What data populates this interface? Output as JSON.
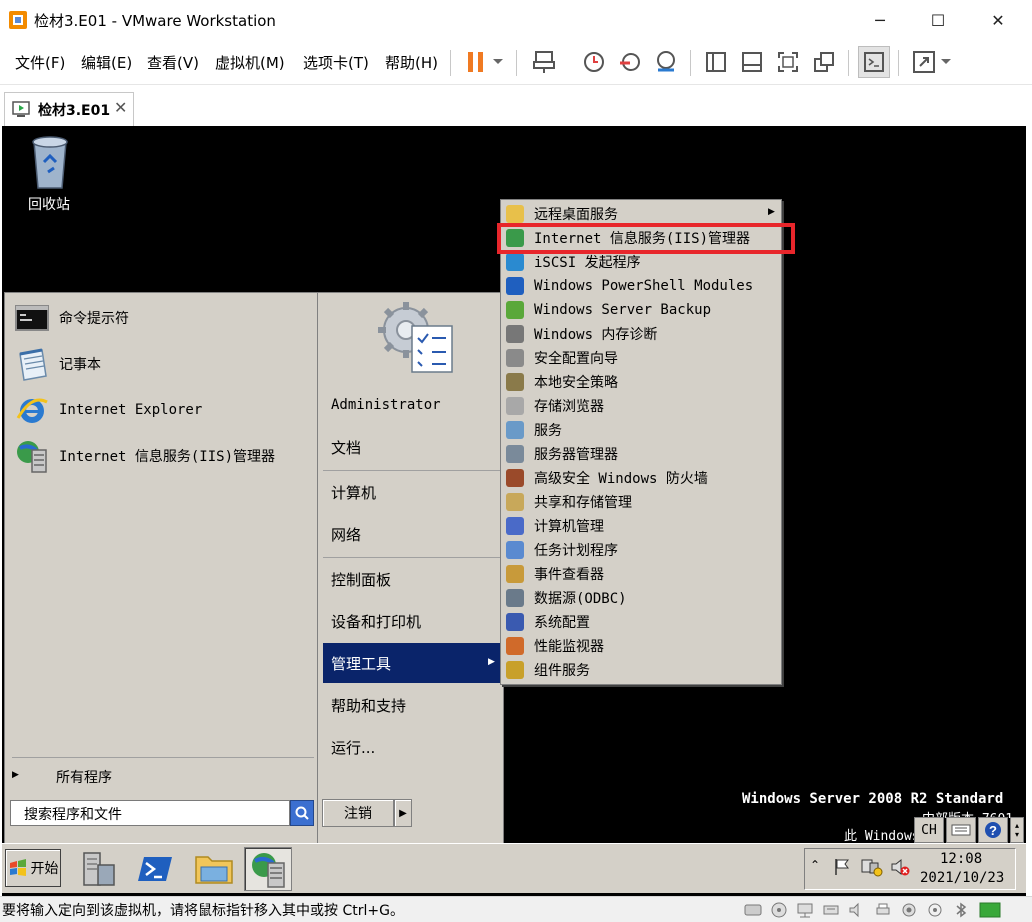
{
  "window": {
    "title": "检材3.E01 - VMware Workstation",
    "minimize": "─",
    "maximize": "☐",
    "close": "✕"
  },
  "menu": [
    "文件(F)",
    "编辑(E)",
    "查看(V)",
    "虚拟机(M)",
    "选项卡(T)",
    "帮助(H)"
  ],
  "tab": {
    "label": "检材3.E01",
    "close": "✕"
  },
  "guest": {
    "desktop": {
      "recycle_bin": "回收站"
    },
    "os_watermark_line1": "Windows Server 2008 R2 Standard",
    "os_watermark_line2": "中部版本 7601",
    "os_watermark_line3": "此 Windows",
    "start_menu": {
      "pinned": [
        "命令提示符",
        "记事本",
        "Internet Explorer",
        "Internet 信息服务(IIS)管理器"
      ],
      "all_programs": "所有程序",
      "search_placeholder": "搜索程序和文件",
      "user": "Administrator",
      "right_links": [
        "文档",
        "计算机",
        "网络",
        "控制面板",
        "设备和打印机",
        "管理工具",
        "帮助和支持",
        "运行..."
      ],
      "logoff": "注销"
    },
    "admin_tools_submenu": [
      "远程桌面服务",
      "Internet 信息服务(IIS)管理器",
      "iSCSI 发起程序",
      "Windows PowerShell Modules",
      "Windows Server Backup",
      "Windows 内存诊断",
      "安全配置向导",
      "本地安全策略",
      "存储浏览器",
      "服务",
      "服务器管理器",
      "高级安全 Windows 防火墙",
      "共享和存储管理",
      "计算机管理",
      "任务计划程序",
      "事件查看器",
      "数据源(ODBC)",
      "系统配置",
      "性能监视器",
      "组件服务"
    ],
    "taskbar": {
      "start": "开始",
      "lang": "CH",
      "time": "12:08",
      "date": "2021/10/23"
    }
  },
  "status": "要将输入定向到该虚拟机，请将鼠标指针移入其中或按 Ctrl+G。",
  "colors": {
    "highlight_box": "#e8262b",
    "menu_selection": "#0a246a",
    "classic_gray": "#d4d0c8",
    "pause_orange": "#f07a22"
  }
}
